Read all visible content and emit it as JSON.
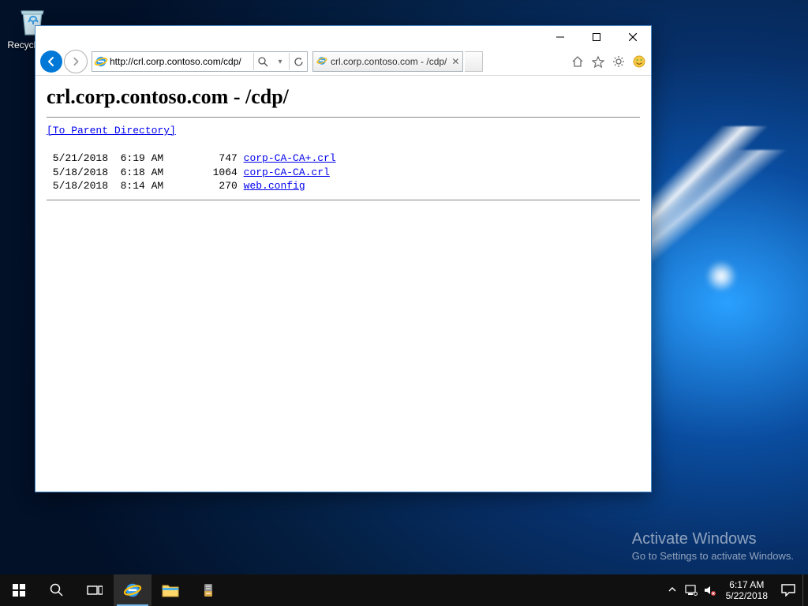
{
  "desktop": {
    "recycle_label": "Recycle Bin"
  },
  "window": {
    "url": "http://crl.corp.contoso.com/cdp/",
    "tab_title": "crl.corp.contoso.com - /cdp/"
  },
  "page": {
    "heading": "crl.corp.contoso.com - /cdp/",
    "parent_link": "[To Parent Directory]",
    "files": [
      {
        "date": " 5/21/2018  6:19 AM",
        "size": "747",
        "name": "corp-CA-CA+.crl"
      },
      {
        "date": " 5/18/2018  6:18 AM",
        "size": "1064",
        "name": "corp-CA-CA.crl"
      },
      {
        "date": " 5/18/2018  8:14 AM",
        "size": "270",
        "name": "web.config"
      }
    ]
  },
  "activate": {
    "title": "Activate Windows",
    "subtitle": "Go to Settings to activate Windows."
  },
  "taskbar": {
    "time": "6:17 AM",
    "date": "5/22/2018"
  }
}
